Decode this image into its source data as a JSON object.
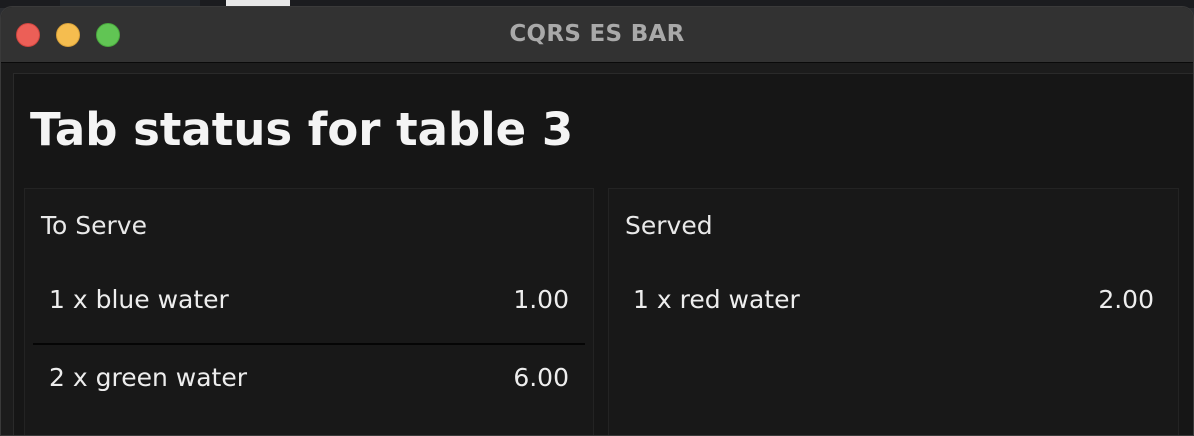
{
  "window": {
    "title": "CQRS ES BAR",
    "controls": [
      "close",
      "minimize",
      "zoom"
    ]
  },
  "page": {
    "title": "Tab status for table 3"
  },
  "to_serve": {
    "heading": "To Serve",
    "items": [
      {
        "label": "1 x blue water",
        "price": "1.00"
      },
      {
        "label": "2 x green water",
        "price": "6.00"
      }
    ]
  },
  "served": {
    "heading": "Served",
    "items": [
      {
        "label": "1 x red water",
        "price": "2.00"
      }
    ]
  },
  "colors": {
    "close": "#ec5f57",
    "minimize": "#f5bd4f",
    "zoom": "#61c554",
    "background": "#161616",
    "text": "#f4f4f4"
  }
}
